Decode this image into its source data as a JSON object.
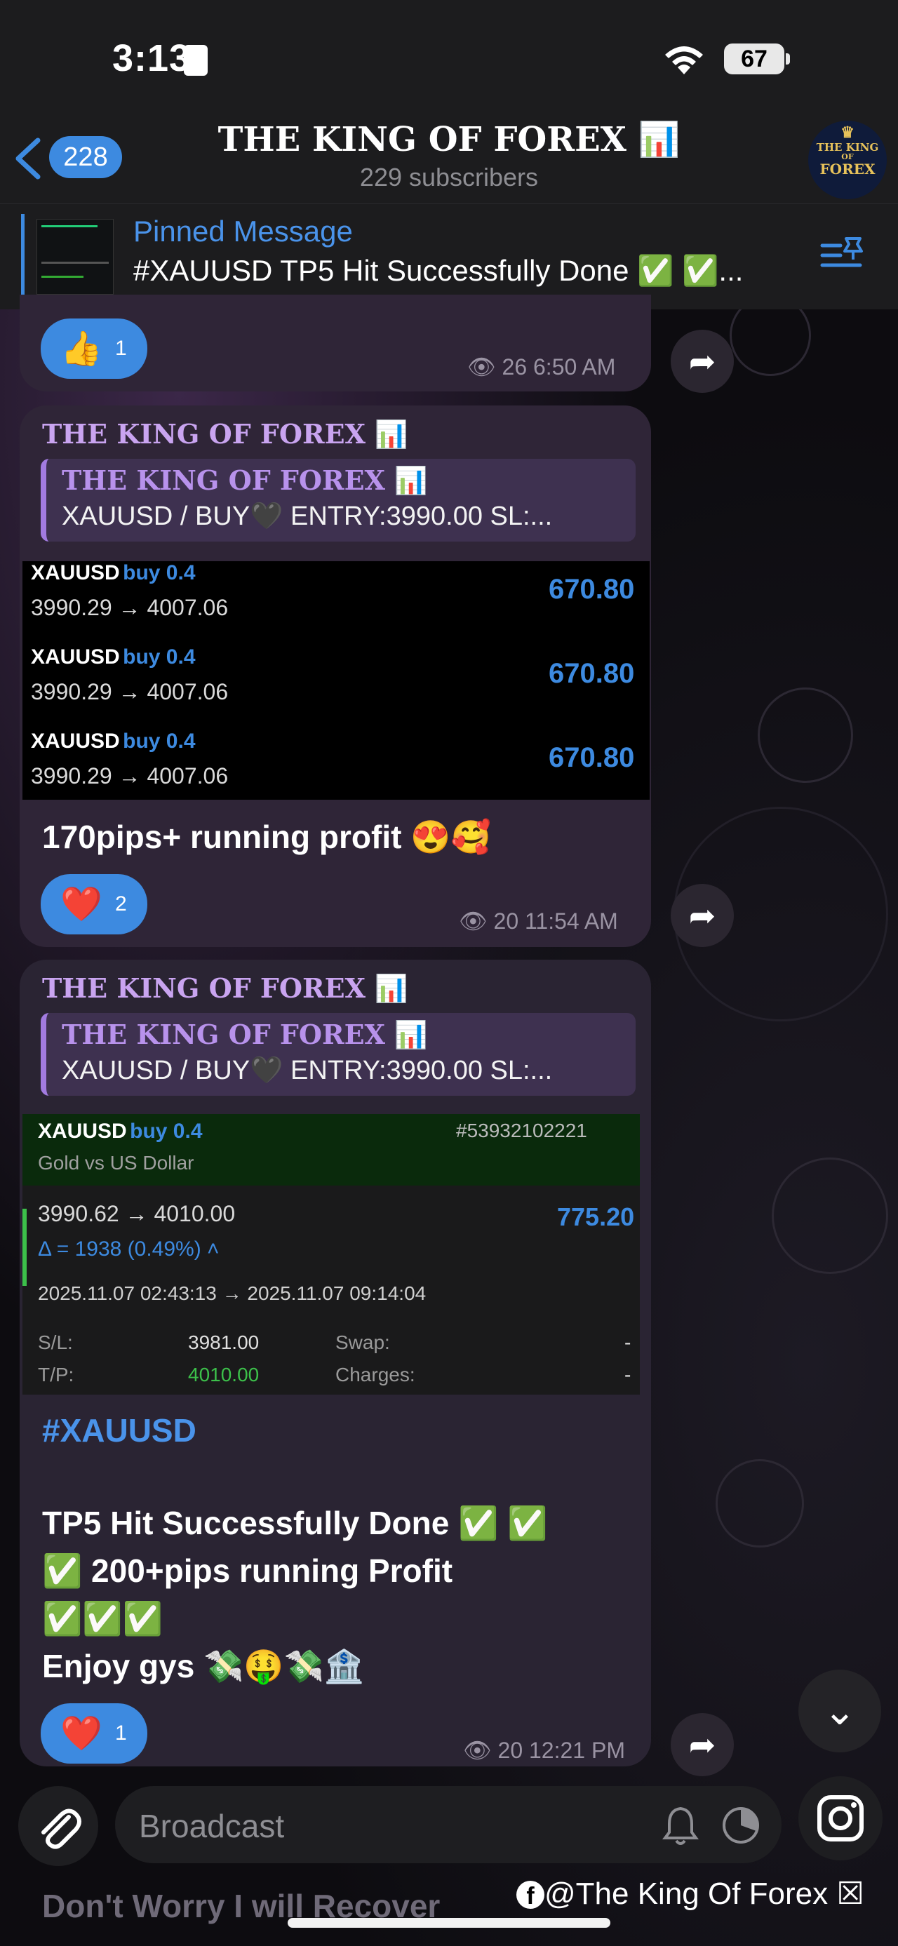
{
  "status_bar": {
    "time": "3:13",
    "battery": "67"
  },
  "header": {
    "back_count": "228",
    "title": "THE KING OF FOREX 📊",
    "subtitle": "229 subscribers",
    "avatar_text": [
      "THE KING",
      "OF",
      "FOREX"
    ]
  },
  "pinned": {
    "label": "Pinned Message",
    "text": "#XAUUSD TP5 Hit Successfully Done ✅ ✅..."
  },
  "messages": [
    {
      "reaction_emoji": "👍",
      "reaction_count": "1",
      "views": "26",
      "time": "6:50 AM"
    },
    {
      "channel": "THE KING OF FOREX 📊",
      "reply_title": "THE KING OF FOREX 📊",
      "reply_text": "XAUUSD / BUY🖤 ENTRY:3990.00 SL:...",
      "trades": [
        {
          "symbol": "XAUUSD",
          "side": "buy 0.4",
          "prices": "3990.29 → 4007.06",
          "profit": "670.80"
        },
        {
          "symbol": "XAUUSD",
          "side": "buy 0.4",
          "prices": "3990.29 → 4007.06",
          "profit": "670.80"
        },
        {
          "symbol": "XAUUSD",
          "side": "buy 0.4",
          "prices": "3990.29 → 4007.06",
          "profit": "670.80"
        }
      ],
      "text": "170pips+ running profit 😍🥰",
      "reaction_emoji": "❤️",
      "reaction_count": "2",
      "views": "20",
      "time": "11:54 AM"
    },
    {
      "channel": "THE KING OF FOREX 📊",
      "reply_title": "THE KING OF FOREX 📊",
      "reply_text": "XAUUSD / BUY🖤 ENTRY:3990.00 SL:...",
      "trade_card": {
        "symbol": "XAUUSD",
        "side": "buy 0.4",
        "order_id": "#53932102221",
        "description": "Gold vs US Dollar",
        "prices": "3990.62 → 4010.00",
        "profit": "775.20",
        "delta": "Δ = 1938 (0.49%) ˄",
        "timestamps": "2025.11.07 02:43:13 → 2025.11.07 09:14:04",
        "sl_label": "S/L:",
        "sl_value": "3981.00",
        "tp_label": "T/P:",
        "tp_value": "4010.00",
        "swap_label": "Swap:",
        "swap_value": "-",
        "charges_label": "Charges:",
        "charges_value": "-"
      },
      "hashtag": "#XAUUSD",
      "lines": [
        "TP5 Hit Successfully Done ✅ ✅",
        "✅ 200+pips running Profit",
        "✅✅✅",
        "Enjoy gys 💸🤑💸🏦"
      ],
      "reaction_emoji": "❤️",
      "reaction_count": "1",
      "views": "20",
      "time": "12:21 PM"
    }
  ],
  "input": {
    "placeholder": "Broadcast"
  },
  "behind_text": "Don't Worry I will Recover",
  "watermark": "@The King Of Forex ☒",
  "colors": {
    "accent": "#3d8ae0",
    "bubble": "#2f2537",
    "profit_green": "#3cc04a"
  }
}
